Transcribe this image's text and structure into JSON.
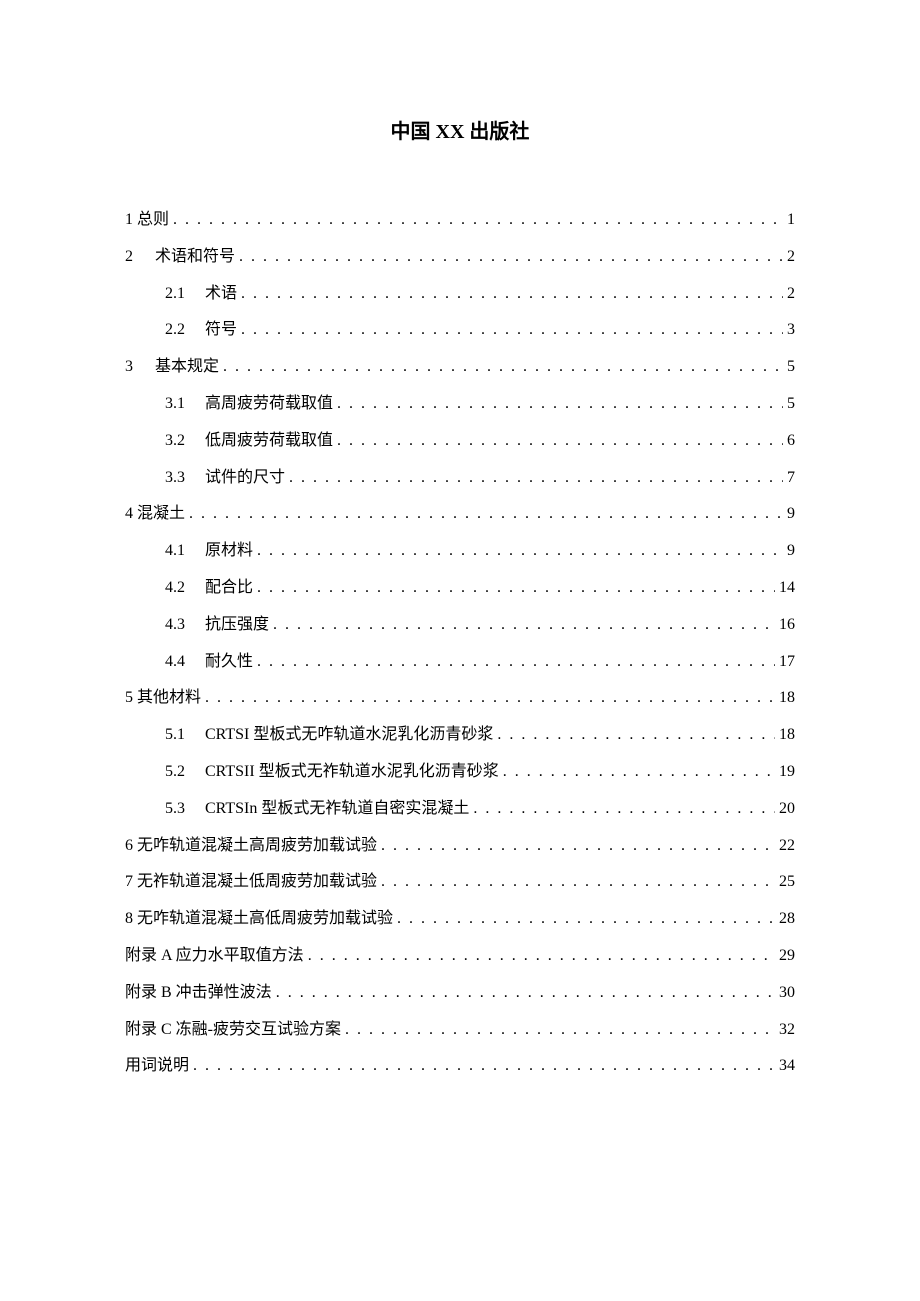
{
  "title": "中国 XX 出版社",
  "toc": [
    {
      "level": 0,
      "num": "1",
      "label": "总则",
      "page": "1",
      "numStyle": "inline"
    },
    {
      "level": 0,
      "num": "2",
      "label": "术语和符号",
      "page": "2",
      "numStyle": "spaced"
    },
    {
      "level": 1,
      "num": "2.1",
      "label": "术语",
      "page": "2"
    },
    {
      "level": 1,
      "num": "2.2",
      "label": "符号",
      "page": "3"
    },
    {
      "level": 0,
      "num": "3",
      "label": "基本规定",
      "page": "5",
      "numStyle": "spaced"
    },
    {
      "level": 1,
      "num": "3.1",
      "label": "高周疲劳荷载取值",
      "page": "5"
    },
    {
      "level": 1,
      "num": "3.2",
      "label": "低周疲劳荷载取值",
      "page": "6"
    },
    {
      "level": 1,
      "num": "3.3",
      "label": "试件的尺寸",
      "page": "7"
    },
    {
      "level": 0,
      "num": "4",
      "label": "混凝土",
      "page": "9",
      "numStyle": "inline"
    },
    {
      "level": 1,
      "num": "4.1",
      "label": "原材料",
      "page": "9"
    },
    {
      "level": 1,
      "num": "4.2",
      "label": "配合比",
      "page": "14"
    },
    {
      "level": 1,
      "num": "4.3",
      "label": "抗压强度",
      "page": "16"
    },
    {
      "level": 1,
      "num": "4.4",
      "label": "耐久性",
      "page": "17"
    },
    {
      "level": 0,
      "num": "5",
      "label": "其他材料",
      "page": "18",
      "numStyle": "inline"
    },
    {
      "level": 1,
      "num": "5.1",
      "label": "CRTSI 型板式无咋轨道水泥乳化沥青砂浆",
      "page": "18"
    },
    {
      "level": 1,
      "num": "5.2",
      "label": "CRTSII 型板式无祚轨道水泥乳化沥青砂浆",
      "page": "19"
    },
    {
      "level": 1,
      "num": "5.3",
      "label": "CRTSIn 型板式无祚轨道自密实混凝土",
      "page": "20"
    },
    {
      "level": 0,
      "num": "6",
      "label": "无咋轨道混凝土高周疲劳加载试验",
      "page": "22",
      "numStyle": "inline"
    },
    {
      "level": 0,
      "num": "7",
      "label": "无祚轨道混凝土低周疲劳加载试验",
      "page": "25",
      "numStyle": "inline"
    },
    {
      "level": 0,
      "num": "8",
      "label": "无咋轨道混凝土高低周疲劳加载试验",
      "page": "28",
      "numStyle": "inline"
    },
    {
      "level": 0,
      "num": "",
      "label": "附录 A 应力水平取值方法",
      "page": "29",
      "numStyle": "none"
    },
    {
      "level": 0,
      "num": "",
      "label": "附录 B 冲击弹性波法",
      "page": "30",
      "numStyle": "none"
    },
    {
      "level": 0,
      "num": "",
      "label": "附录 C 冻融-疲劳交互试验方案",
      "page": "32",
      "numStyle": "none"
    },
    {
      "level": 0,
      "num": "",
      "label": "用词说明",
      "page": "34",
      "numStyle": "none"
    }
  ]
}
